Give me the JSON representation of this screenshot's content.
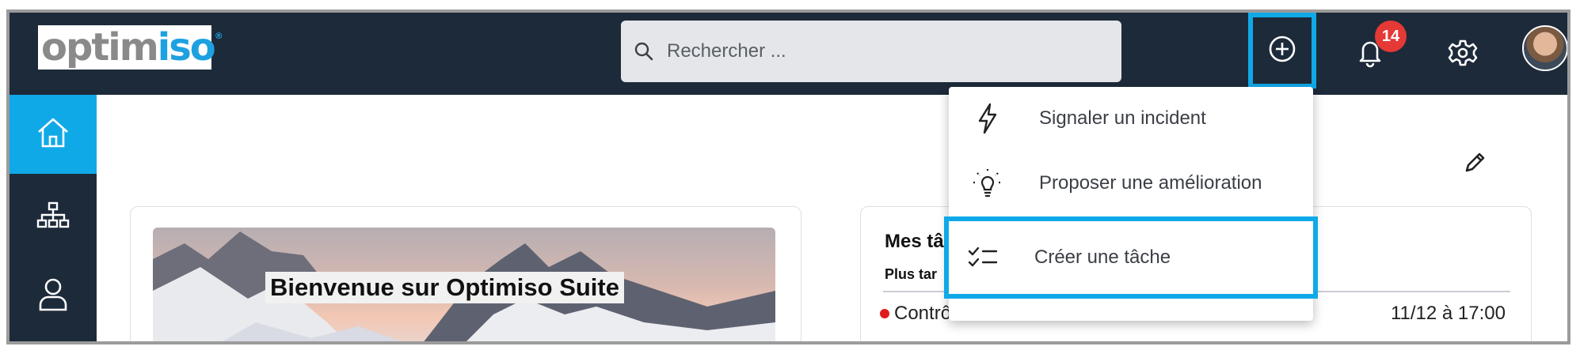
{
  "colors": {
    "nav_bg": "#1d2a3a",
    "accent": "#10a9e8",
    "badge": "#e53935",
    "logo_grey": "#8a8a8a",
    "logo_blue": "#1ea1e0"
  },
  "logo": {
    "part1": "optim",
    "part2": "iso",
    "reg": "®"
  },
  "search": {
    "placeholder": "Rechercher ...",
    "icon": "search-icon"
  },
  "header": {
    "add_icon": "plus-circle-icon",
    "notifications": {
      "icon": "bell-icon",
      "count": "14"
    },
    "settings_icon": "gear-icon",
    "avatar": "user-avatar"
  },
  "sidebar": {
    "items": [
      {
        "icon": "home-icon",
        "active": true
      },
      {
        "icon": "org-chart-icon",
        "active": false
      },
      {
        "icon": "user-icon",
        "active": false
      }
    ]
  },
  "quick_add_menu": {
    "items": [
      {
        "icon": "lightning-icon",
        "label": "Signaler un incident"
      },
      {
        "icon": "lightbulb-icon",
        "label": "Proposer une amélioration"
      },
      {
        "icon": "checklist-icon",
        "label": "Créer une tâche",
        "highlighted": true
      }
    ]
  },
  "welcome_card": {
    "title": "Bienvenue sur Optimiso Suite"
  },
  "tasks_card": {
    "title": "Mes tâ",
    "subtitle": "Plus tar",
    "rows": [
      {
        "status": "overdue",
        "status_color": "#e01b1b",
        "label": "Contrôle des visites clients",
        "due": "11/12 à 17:00"
      }
    ]
  },
  "edit_icon": "pencil-icon"
}
